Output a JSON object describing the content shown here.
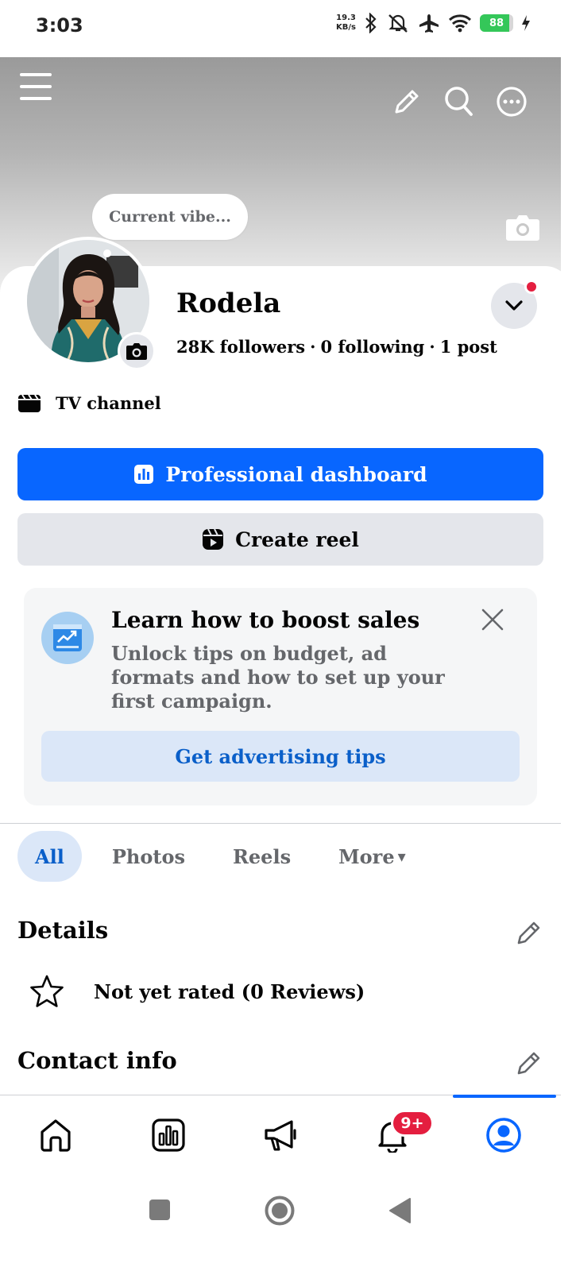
{
  "status_bar": {
    "time": "3:03",
    "net_speed_value": "19.3",
    "net_speed_unit": "KB/s",
    "battery_level": "88",
    "battery_fraction": 0.88
  },
  "header": {
    "icons": [
      "menu-icon",
      "edit-icon",
      "search-icon",
      "more-icon"
    ]
  },
  "profile": {
    "vibe_prompt": "Current vibe...",
    "name": "Rodela",
    "followers": "28K followers",
    "following": "0 following",
    "posts": "1 post",
    "stats_separator": "·",
    "category": "TV channel"
  },
  "actions": {
    "primary_label": "Professional dashboard",
    "secondary_label": "Create reel"
  },
  "boost_card": {
    "title": "Learn how to boost sales",
    "text": "Unlock tips on budget, ad formats and how to set up your first campaign.",
    "button_label": "Get advertising tips"
  },
  "filters": {
    "tabs": [
      "All",
      "Photos",
      "Reels",
      "More"
    ],
    "more_suffix": "▾",
    "active": "All"
  },
  "details": {
    "title": "Details",
    "rating_text": "Not yet rated (0 Reviews)"
  },
  "contact": {
    "title": "Contact info"
  },
  "bottom_nav": {
    "items": [
      "home-icon",
      "dashboard-icon",
      "megaphone-icon",
      "notifications-icon",
      "profile-icon"
    ],
    "notification_badge": "9+",
    "active": "profile-icon"
  },
  "colors": {
    "primary": "#0866ff",
    "badge": "#e41e3f",
    "link": "#0a5fc9"
  }
}
